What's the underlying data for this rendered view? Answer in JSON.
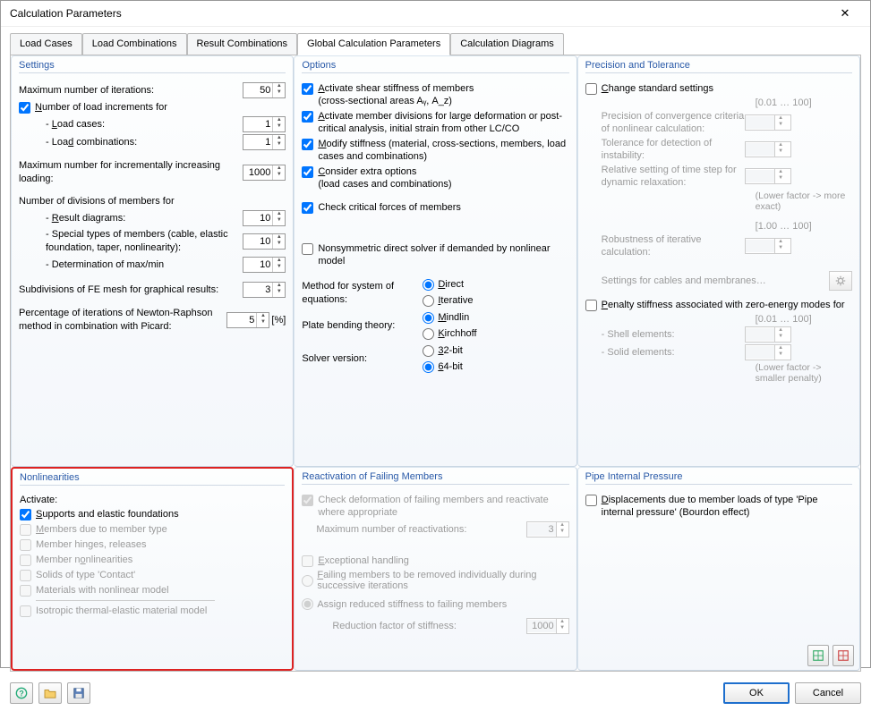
{
  "window": {
    "title": "Calculation Parameters",
    "close": "✕"
  },
  "tabs": [
    {
      "label": "Load Cases"
    },
    {
      "label": "Load Combinations"
    },
    {
      "label": "Result Combinations"
    },
    {
      "label": "Global Calculation Parameters"
    },
    {
      "label": "Calculation Diagrams"
    }
  ],
  "settings": {
    "title": "Settings",
    "max_iter_label": "Maximum number of iterations:",
    "max_iter_value": "50",
    "load_inc_label": "Number of load increments for",
    "load_cases_label": "Load cases:",
    "load_cases_value": "1",
    "load_combos_label": "Load combinations:",
    "load_combos_value": "1",
    "inc_loading_label": "Maximum number for incrementally increasing loading:",
    "inc_loading_value": "1000",
    "div_members_label": "Number of divisions of members for",
    "result_diagrams_label": "Result diagrams:",
    "result_diagrams_value": "10",
    "special_types_label": "Special types of members (cable, elastic foundation, taper, nonlinearity):",
    "special_types_value": "10",
    "maxmin_label": "Determination of max/min",
    "maxmin_value": "10",
    "fe_mesh_label": "Subdivisions of FE mesh for graphical results:",
    "fe_mesh_value": "3",
    "picard_label": "Percentage of iterations of Newton-Raphson method in combination with Picard:",
    "picard_value": "5",
    "picard_unit": "[%]"
  },
  "options": {
    "title": "Options",
    "shear": "Activate shear stiffness of members",
    "shear_sub": "(cross-sectional areas Aᵧ, A_z)",
    "large_def": "Activate member divisions for large deformation or post-critical analysis, initial strain from other LC/CO",
    "modify": "Modify stiffness (material, cross-sections, members, load cases and combinations)",
    "extra": "Consider extra options",
    "extra_sub": "(load cases and combinations)",
    "critical": "Check critical forces of members",
    "nonsym": "Nonsymmetric direct solver if demanded by nonlinear model",
    "method_label": "Method for system of equations:",
    "method_direct": "Direct",
    "method_iterative": "Iterative",
    "plate_label": "Plate bending theory:",
    "plate_mindlin": "Mindlin",
    "plate_kirchhoff": "Kirchhoff",
    "solver_label": "Solver version:",
    "solver_32": "32-bit",
    "solver_64": "64-bit"
  },
  "precision": {
    "title": "Precision and Tolerance",
    "change": "Change standard settings",
    "range1": "[0.01 … 100]",
    "conv_label": "Precision of convergence criteria of nonlinear calculation:",
    "instab_label": "Tolerance for detection of instability:",
    "relax_label": "Relative setting of time step for dynamic relaxation:",
    "note1": "(Lower factor -> more exact)",
    "range2": "[1.00 … 100]",
    "robust_label": "Robustness of iterative calculation:",
    "cables_label": "Settings for cables and membranes…",
    "penalty": "Penalty stiffness associated with zero-energy modes for",
    "range3": "[0.01 … 100]",
    "shell_label": "- Shell elements:",
    "solid_label": "- Solid elements:",
    "note2": "(Lower factor -> smaller penalty)"
  },
  "nonlin": {
    "title": "Nonlinearities",
    "activate": "Activate:",
    "supports": "Supports and elastic foundations",
    "members_type": "Members due to member type",
    "hinges": "Member hinges, releases",
    "member_nl": "Member nonlinearities",
    "solids": "Solids of type 'Contact'",
    "materials": "Materials with nonlinear model",
    "iso": "Isotropic thermal-elastic material model"
  },
  "react": {
    "title": "Reactivation of Failing Members",
    "check": "Check deformation of failing members and reactivate where appropriate",
    "max_label": "Maximum number of reactivations:",
    "max_value": "3",
    "except": "Exceptional handling",
    "remove": "Failing members to be removed individually during successive iterations",
    "assign": "Assign reduced stiffness to failing members",
    "reduction_label": "Reduction factor of stiffness:",
    "reduction_value": "1000"
  },
  "pipe": {
    "title": "Pipe Internal Pressure",
    "disp": "Displacements due to member loads of type 'Pipe internal pressure' (Bourdon effect)"
  },
  "footer": {
    "ok": "OK",
    "cancel": "Cancel"
  }
}
